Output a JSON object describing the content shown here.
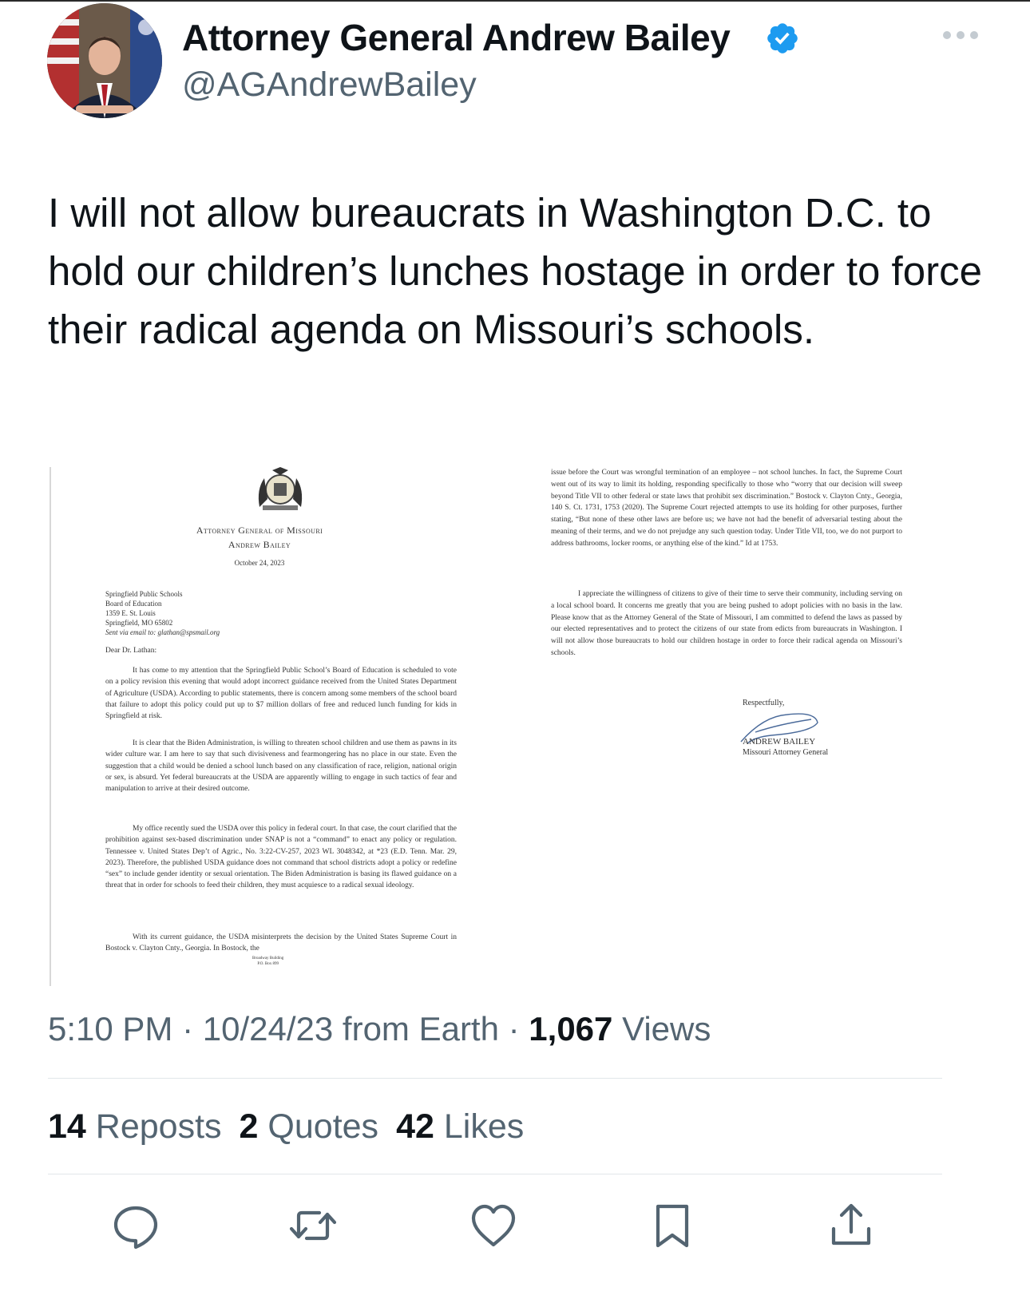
{
  "author": {
    "display_name": "Attorney General Andrew Bailey",
    "handle": "@AGAndrewBailey",
    "verified_color": "#1d9bf0"
  },
  "tweet": {
    "text": "I will not allow bureaucrats in Washington D.C. to hold our children’s lunches hostage in order to force their radical agenda on Missouri’s schools."
  },
  "letter": {
    "page1": {
      "office_title": "Attorney General of Missouri",
      "officer_name": "Andrew Bailey",
      "date": "October 24, 2023",
      "recipient_lines": [
        "Springfield Public Schools",
        "Board of Education",
        "1359 E. St. Louis",
        "Springfield, MO 65802"
      ],
      "sent_via": "Sent via email to: glathan@spsmail.org",
      "salutation": "Dear Dr. Lathan:",
      "paragraphs": [
        "It has come to my attention that the Springfield Public School’s Board of Education is scheduled to vote on a policy revision this evening that would adopt incorrect guidance received from the United States Department of Agriculture (USDA). According to public statements, there is concern among some members of the school board that failure to adopt this policy could put up to $7 million dollars of free and reduced lunch funding for kids in Springfield at risk.",
        "It is clear that the Biden Administration, is willing to threaten school children and use them as pawns in its wider culture war. I am here to say that such divisiveness and fearmongering has no place in our state. Even the suggestion that a child would be denied a school lunch based on any classification of race, religion, national origin or sex, is absurd. Yet federal bureaucrats at the USDA are apparently willing to engage in such tactics of fear and manipulation to arrive at their desired outcome.",
        "My office recently sued the USDA over this policy in federal court. In that case, the court clarified that the prohibition against sex-based discrimination under SNAP is not a “command” to enact any policy or regulation. Tennessee v. United States Dep’t of Agric., No. 3:22-CV-257, 2023 WL 3048342, at *23 (E.D. Tenn. Mar. 29, 2023). Therefore, the published USDA guidance does not command that school districts adopt a policy or redefine “sex” to include gender identity or sexual orientation. The Biden Administration is basing its flawed guidance on a threat that in order for schools to feed their children, they must acquiesce to a radical sexual ideology.",
        "With its current guidance, the USDA misinterprets the decision by the United States Supreme Court in Bostock v. Clayton Cnty., Georgia. In Bostock, the"
      ],
      "footer_lines": [
        "Broadway Building",
        "P.O. Box 899"
      ]
    },
    "page2": {
      "paragraphs": [
        "issue before the Court was wrongful termination of an employee – not school lunches. In fact, the Supreme Court went out of its way to limit its holding, responding specifically to those who “worry that our decision will sweep beyond Title VII to other federal or state laws that prohibit sex discrimination.” Bostock v. Clayton Cnty., Georgia, 140 S. Ct. 1731, 1753 (2020). The Supreme Court rejected attempts to use its holding for other purposes, further stating, “But none of these other laws are before us; we have not had the benefit of adversarial testing about the meaning of their terms, and we do not prejudge any such question today. Under Title VII, too, we do not purport to address bathrooms, locker rooms, or anything else of the kind.” Id at 1753.",
        "I appreciate the willingness of citizens to give of their time to serve their community, including serving on a local school board. It concerns me greatly that you are being pushed to adopt policies with no basis in the law. Please know that as the Attorney General of the State of Missouri, I am committed to defend the laws as passed by our elected representatives and to protect the citizens of our state from edicts from bureaucrats in Washington. I will not allow those bureaucrats to hold our children hostage in order to force their radical agenda on Missouri’s schools."
      ],
      "closing": "Respectfully,",
      "signer_name": "ANDREW BAILEY",
      "signer_title": "Missouri Attorney General"
    }
  },
  "meta": {
    "time": "5:10 PM",
    "sep": " · ",
    "date_source": "10/24/23 from Earth",
    "views_count": "1,067",
    "views_label": " Views"
  },
  "stats": {
    "reposts_count": "14",
    "reposts_label": " Reposts",
    "quotes_count": "2",
    "quotes_label": " Quotes",
    "likes_count": "42",
    "likes_label": " Likes"
  },
  "actions": [
    "reply-icon",
    "repost-icon",
    "like-icon",
    "bookmark-icon",
    "share-icon"
  ]
}
